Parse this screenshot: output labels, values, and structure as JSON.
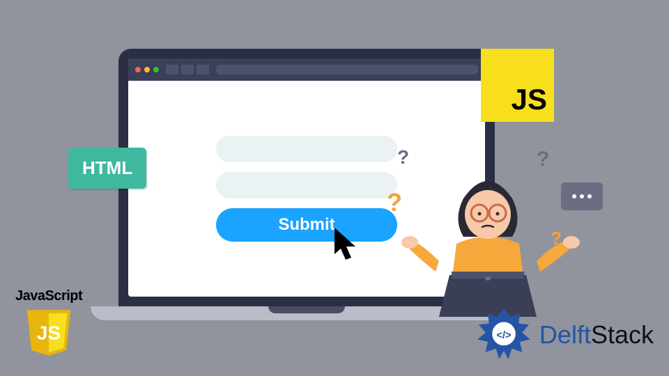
{
  "form": {
    "submit_label": "Submit"
  },
  "badges": {
    "html": "HTML",
    "js": "JS"
  },
  "bottom_left": {
    "label": "JavaScript",
    "shield_text": "JS"
  },
  "bottom_right": {
    "brand": "DelftStack"
  }
}
